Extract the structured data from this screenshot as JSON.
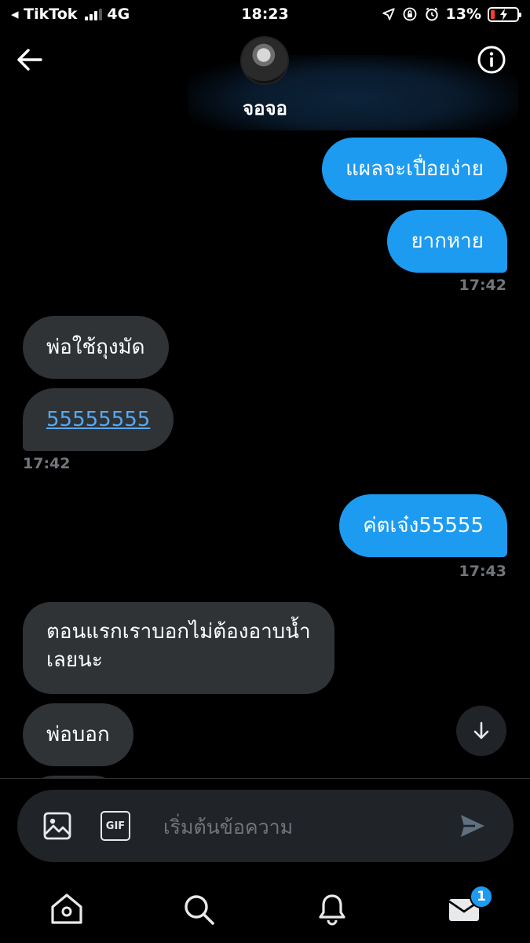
{
  "status_bar": {
    "back_app": "◂ TikTok",
    "network": "4G",
    "time": "18:23",
    "battery": "13%"
  },
  "header": {
    "contact_name": "จอจอ"
  },
  "messages": [
    {
      "text": "แผลจะเปื่อยง่าย"
    },
    {
      "text": "ยากหาย"
    },
    {
      "timestamp": "17:42"
    },
    {
      "text": "พ่อใช้ถุงมัด"
    },
    {
      "text": "55555555"
    },
    {
      "timestamp": "17:42"
    },
    {
      "text": "ค่ตเจ๋ง55555"
    },
    {
      "timestamp": "17:43"
    },
    {
      "text_line1": "ตอนแรกเราบอกไม่ต้องอาบน้ำ",
      "text_line2": "เลยนะ"
    },
    {
      "text": "พ่อบอก"
    }
  ],
  "composer": {
    "placeholder": "เริ่มต้นข้อความ",
    "gif_label": "GIF"
  },
  "bottom_nav": {
    "messages_badge": "1"
  },
  "colors": {
    "accent": "#1d9bf0",
    "received_bubble": "#2f3336",
    "background": "#000000",
    "timestamp": "#71767b"
  }
}
